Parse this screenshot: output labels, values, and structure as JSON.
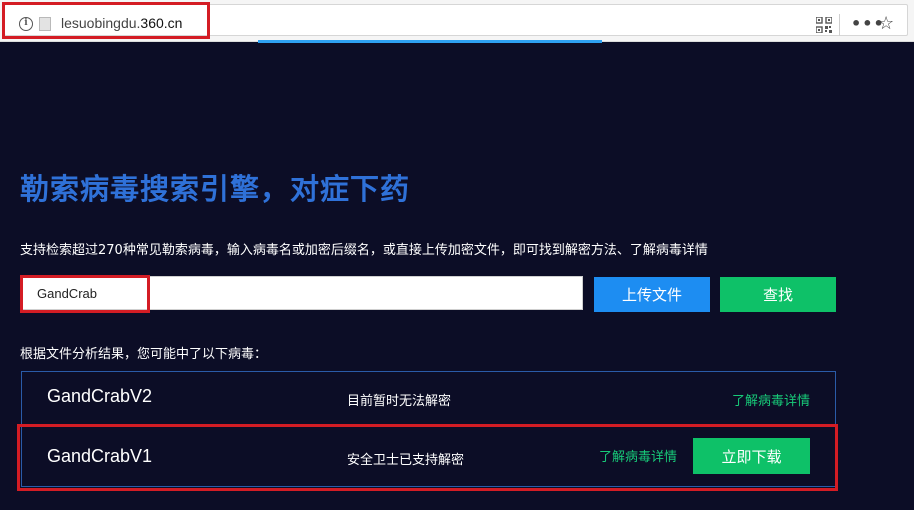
{
  "browser": {
    "url_prefix": "lesuobingdu.",
    "url_domain": "360.cn",
    "info_glyph": "i",
    "icons": [
      "info-icon",
      "page-icon",
      "qr-code-icon",
      "more-icon",
      "star-icon"
    ]
  },
  "hero": {
    "title": "勒索病毒搜索引擎，对症下药",
    "description": "支持检索超过270种常见勒索病毒，输入病毒名或加密后缀名，或直接上传加密文件，即可找到解密方法、了解病毒详情"
  },
  "search": {
    "value": "GandCrab",
    "upload_label": "上传文件",
    "search_label": "查找"
  },
  "results": {
    "label": "根据文件分析结果，您可能中了以下病毒：",
    "items": [
      {
        "name": "GandCrabV2",
        "status": "目前暂时无法解密",
        "link": "了解病毒详情"
      },
      {
        "name": "GandCrabV1",
        "status": "安全卫士已支持解密",
        "link": "了解病毒详情",
        "action": "立即下载"
      }
    ]
  },
  "colors": {
    "background": "#0c0d26",
    "title": "#2f71d8",
    "upload_button": "#1d8df2",
    "green": "#0ec168",
    "highlight": "#d41c24"
  }
}
